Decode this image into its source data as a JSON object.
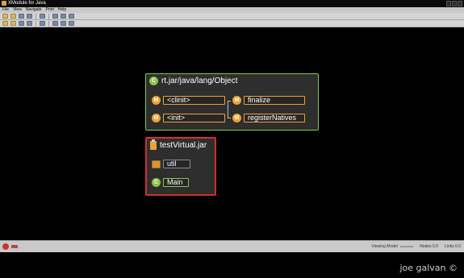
{
  "window": {
    "title": "XModule for Java"
  },
  "menu": [
    "File",
    "View",
    "Navigate",
    "Print",
    "Help"
  ],
  "toolbar1": [
    "open-icon",
    "open-folder-icon",
    "save-icon",
    "save-as-icon",
    "print-icon",
    "layout-icon",
    "zoom-icon",
    "window-icon"
  ],
  "toolbar2": [
    "open-icon",
    "open-folder-icon",
    "save-icon",
    "save-as-icon",
    "print-icon",
    "layout-icon",
    "zoom-icon",
    "window-icon"
  ],
  "modules": {
    "rt": {
      "title": "rt.jar/java/lang/Object",
      "badge": "C",
      "methods": [
        {
          "badge": "M",
          "label": "<clinit>"
        },
        {
          "badge": "M",
          "label": "finalize"
        },
        {
          "badge": "M",
          "label": "<init>"
        },
        {
          "badge": "M",
          "label": "registerNatives"
        }
      ]
    },
    "test": {
      "title": "testVirtual.jar",
      "package": "util",
      "class": {
        "badge": "C",
        "label": "Main"
      }
    }
  },
  "status": {
    "viewing_model": "Viewing Model",
    "nodes": "Nodes 0.0",
    "links": "Links 0.0"
  },
  "watermark": "joe galvan ©",
  "colors": {
    "class_green": "#8bc34a",
    "method_orange": "#f0a030",
    "jar_red": "#d32f2f"
  }
}
